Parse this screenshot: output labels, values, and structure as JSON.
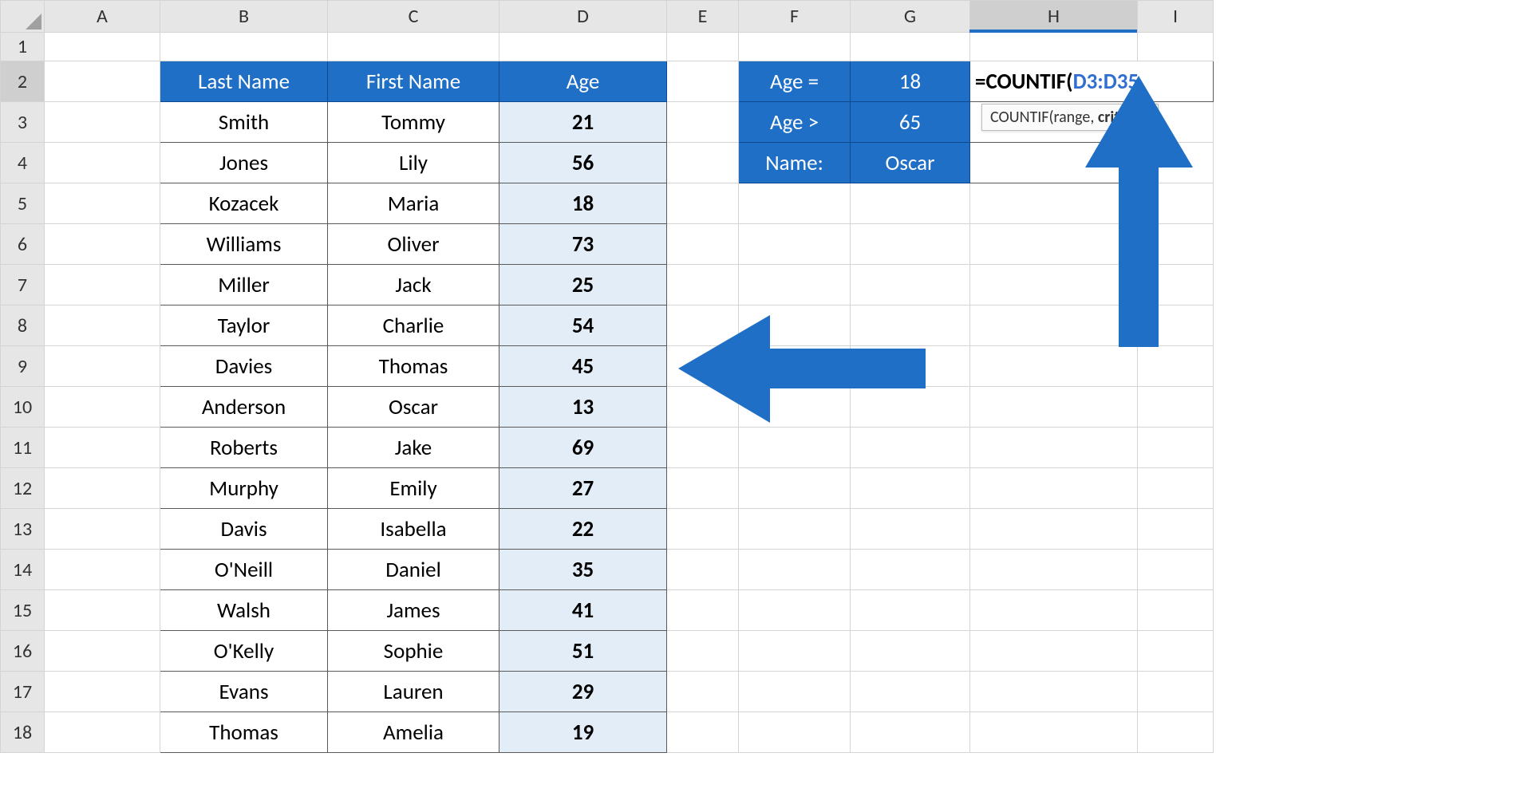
{
  "columns": [
    "A",
    "B",
    "C",
    "D",
    "E",
    "F",
    "G",
    "H",
    "I"
  ],
  "rows": [
    "1",
    "2",
    "3",
    "4",
    "5",
    "6",
    "7",
    "8",
    "9",
    "10",
    "11",
    "12",
    "13",
    "14",
    "15",
    "16",
    "17",
    "18"
  ],
  "selected_column": "H",
  "selected_row": "2",
  "headers": {
    "B": "Last Name",
    "C": "First Name",
    "D": "Age"
  },
  "people": [
    {
      "last": "Smith",
      "first": "Tommy",
      "age": "21"
    },
    {
      "last": "Jones",
      "first": "Lily",
      "age": "56"
    },
    {
      "last": "Kozacek",
      "first": "Maria",
      "age": "18"
    },
    {
      "last": "Williams",
      "first": "Oliver",
      "age": "73"
    },
    {
      "last": "Miller",
      "first": "Jack",
      "age": "25"
    },
    {
      "last": "Taylor",
      "first": "Charlie",
      "age": "54"
    },
    {
      "last": "Davies",
      "first": "Thomas",
      "age": "45"
    },
    {
      "last": "Anderson",
      "first": "Oscar",
      "age": "13"
    },
    {
      "last": "Roberts",
      "first": "Jake",
      "age": "69"
    },
    {
      "last": "Murphy",
      "first": "Emily",
      "age": "27"
    },
    {
      "last": "Davis",
      "first": "Isabella",
      "age": "22"
    },
    {
      "last": "O'Neill",
      "first": "Daniel",
      "age": "35"
    },
    {
      "last": "Walsh",
      "first": "James",
      "age": "41"
    },
    {
      "last": "O'Kelly",
      "first": "Sophie",
      "age": "51"
    },
    {
      "last": "Evans",
      "first": "Lauren",
      "age": "29"
    },
    {
      "last": "Thomas",
      "first": "Amelia",
      "age": "19"
    }
  ],
  "criteria_table": [
    {
      "label": "Age =",
      "value": "18"
    },
    {
      "label": "Age >",
      "value": "65"
    },
    {
      "label": "Name:",
      "value": "Oscar"
    }
  ],
  "formula": {
    "prefix": "=COUNTIF(",
    "range": "D3:D35",
    "suffix": ","
  },
  "tooltip": {
    "fn": "COUNTIF(",
    "arg1": "range, ",
    "arg2_bold": "criteria",
    "close": ")"
  }
}
